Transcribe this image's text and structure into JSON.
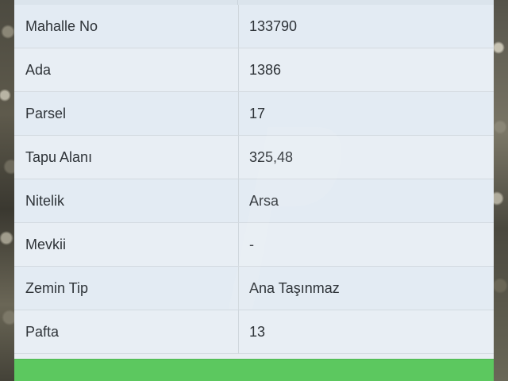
{
  "parcel_info": {
    "rows": [
      {
        "label": "Mahalle No",
        "value": "133790"
      },
      {
        "label": "Ada",
        "value": "1386"
      },
      {
        "label": "Parsel",
        "value": "17"
      },
      {
        "label": "Tapu Alanı",
        "value": "325,48"
      },
      {
        "label": "Nitelik",
        "value": "Arsa"
      },
      {
        "label": "Mevkii",
        "value": "-"
      },
      {
        "label": "Zemin Tip",
        "value": "Ana Taşınmaz"
      },
      {
        "label": "Pafta",
        "value": "13"
      }
    ]
  },
  "colors": {
    "action_bar": "#5cc85f",
    "row_background": "#e3ebf3",
    "text": "#2e3338"
  }
}
